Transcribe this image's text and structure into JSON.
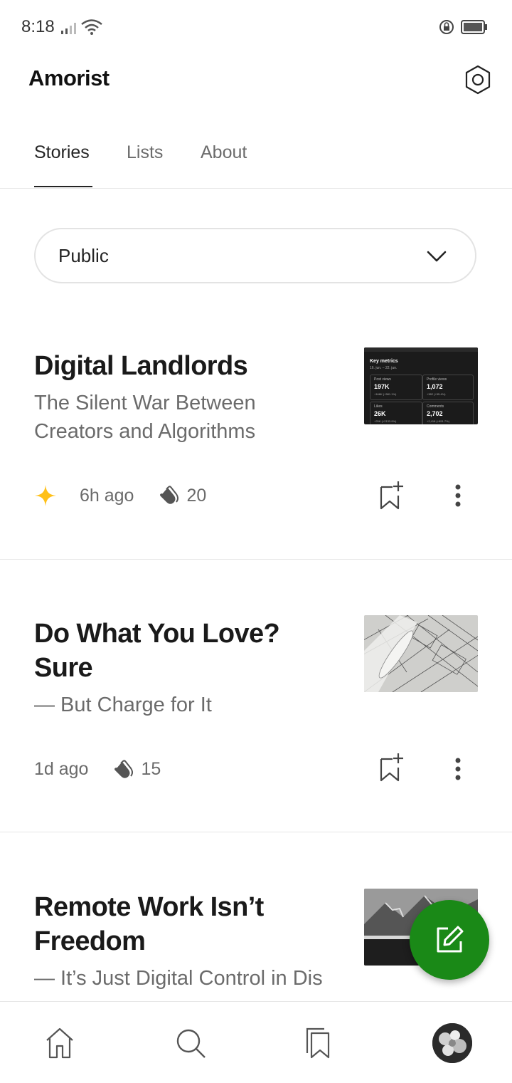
{
  "status_bar": {
    "time": "8:18"
  },
  "header": {
    "title": "Amorist"
  },
  "tabs": [
    {
      "label": "Stories",
      "active": true
    },
    {
      "label": "Lists"
    },
    {
      "label": "About"
    }
  ],
  "filter": {
    "selected": "Public"
  },
  "stories": [
    {
      "title": "Digital Landlords",
      "subtitle": "The Silent War Between Creators and Algorithms",
      "member_only": true,
      "time": "6h ago",
      "claps": "20",
      "thumbnail": {
        "heading": "Key metrics",
        "date_range": "16. jun. – 22. jun.",
        "metrics": [
          {
            "label": "Post views",
            "value": "197K",
            "change": "+168K (+581.1%)"
          },
          {
            "label": "Profile views",
            "value": "1,072",
            "change": "+382 (+55.4%)"
          },
          {
            "label": "Likes",
            "value": "26K",
            "change": "+25K (+2133.9%)"
          },
          {
            "label": "Comments",
            "value": "2,702",
            "change": "+2,418 (+851.7%)"
          }
        ]
      }
    },
    {
      "title": "Do What You Love? Sure",
      "subtitle": "— But Charge for It",
      "time": "1d ago",
      "claps": "15"
    },
    {
      "title": "Remote Work Isn’t Freedom",
      "subtitle": "— It’s Just Digital Control in Dis"
    }
  ],
  "colors": {
    "accent": "#1a8917",
    "star": "#ffc017",
    "text": "#242424",
    "muted": "#6b6b6b"
  },
  "icons": {
    "settings": "gear-icon",
    "dropdown": "chevron-down-icon",
    "bookmark": "bookmark-add-icon",
    "more": "more-vertical-icon",
    "compose": "edit-icon",
    "home": "home-icon",
    "search": "search-icon",
    "library": "library-icon",
    "avatar": "avatar"
  }
}
